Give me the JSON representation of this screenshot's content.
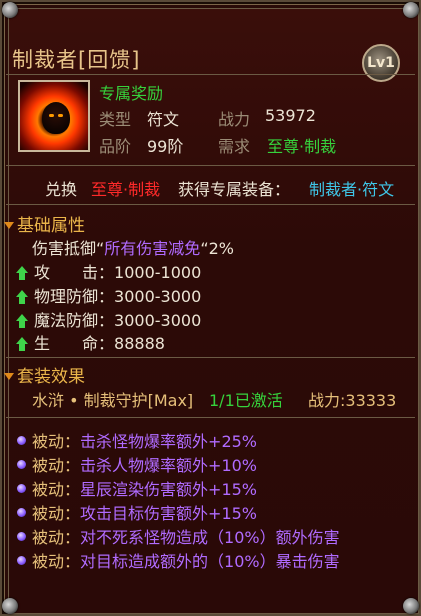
{
  "item": {
    "name": "制裁者[回馈]",
    "level_badge": "Lv1",
    "reward_tag": "专属奖励",
    "type_label": "类型",
    "type_value": "符文",
    "power_label": "战力",
    "power_value": "53972",
    "grade_label": "品阶",
    "grade_value": "99阶",
    "require_label": "需求",
    "require_value": "至尊·制裁"
  },
  "exchange": {
    "prefix": "兑换",
    "source": "至尊·制裁",
    "middle": "获得专属装备：",
    "target": "制裁者·符文"
  },
  "base_attributes": {
    "header": "基础属性",
    "special_prefix": "伤害抵御“",
    "special_name": "所有伤害减免",
    "special_suffix": "“2%",
    "stats": [
      {
        "label": "攻　　击",
        "value": "1000-1000"
      },
      {
        "label": "物理防御",
        "value": "3000-3000"
      },
      {
        "label": "魔法防御",
        "value": "3000-3000"
      },
      {
        "label": "生　　命",
        "value": "88888"
      }
    ]
  },
  "set_effect": {
    "header": "套装效果",
    "set_name": "水浒 • 制裁守护[Max]",
    "activated": "1/1已激活",
    "power": "战力:33333"
  },
  "passives": [
    {
      "tag": "被动：",
      "text": "击杀怪物爆率额外",
      "bonus": "+25%"
    },
    {
      "tag": "被动：",
      "text": "击杀人物爆率额外",
      "bonus": "+10%"
    },
    {
      "tag": "被动：",
      "text": "星辰渲染伤害额外",
      "bonus": "+15%"
    },
    {
      "tag": "被动：",
      "text": "攻击目标伤害额外",
      "bonus": "+15%"
    },
    {
      "tag": "被动：",
      "text": "对不死系怪物造成（10%）额外伤害",
      "bonus": ""
    },
    {
      "tag": "被动：",
      "text": "对目标造成额外的（10%）暴击伤害",
      "bonus": ""
    }
  ]
}
